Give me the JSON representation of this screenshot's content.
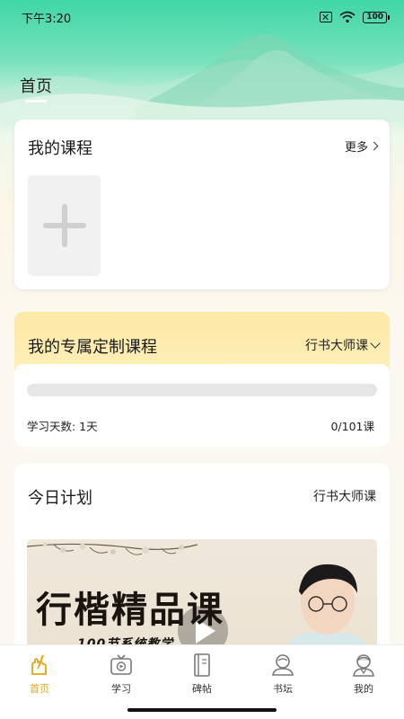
{
  "status_bar": {
    "time": "下午3:20",
    "battery": "100"
  },
  "header": {
    "title": "首页"
  },
  "my_courses": {
    "title": "我的课程",
    "more_label": "更多"
  },
  "custom_course": {
    "title": "我的专属定制课程",
    "selected_course": "行书大师课",
    "progress_fraction": 0.0,
    "study_days": "学习天数: 1天",
    "lesson_count": "0/101课"
  },
  "today_plan": {
    "title": "今日计划",
    "course": "行书大师课",
    "banner_title": "行楷精品课",
    "banner_subtitle": "100节系统教学"
  },
  "tabbar": {
    "items": [
      {
        "label": "首页",
        "icon": "brush-hand-icon",
        "active": true
      },
      {
        "label": "学习",
        "icon": "tv-icon",
        "active": false
      },
      {
        "label": "碑帖",
        "icon": "book-icon",
        "active": false
      },
      {
        "label": "书坛",
        "icon": "forum-icon",
        "active": false
      },
      {
        "label": "我的",
        "icon": "profile-icon",
        "active": false
      }
    ]
  },
  "colors": {
    "accent": "#e6a512",
    "hero_green": "#3fd6a6",
    "custom_card_yellow": "#fde9a6"
  }
}
